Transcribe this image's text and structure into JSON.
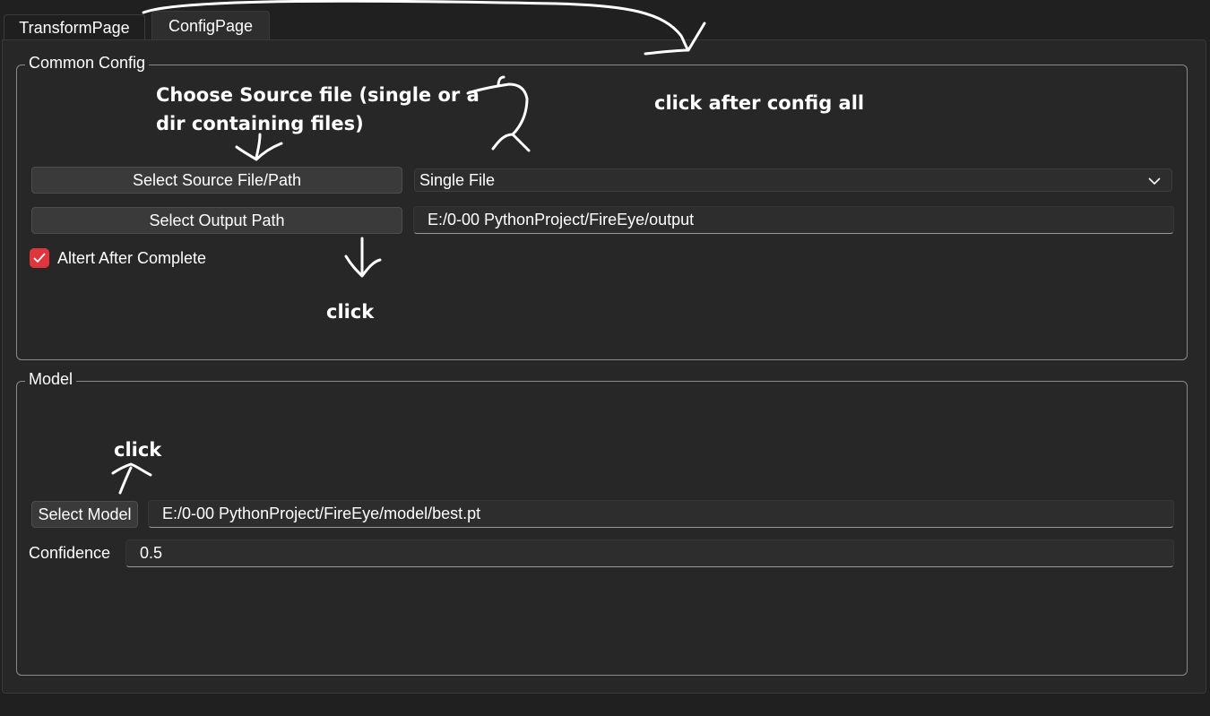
{
  "tabs": {
    "transform_label": "TransformPage",
    "config_label": "ConfigPage",
    "active": "ConfigPage"
  },
  "common_config": {
    "title": "Common Config",
    "select_source_label": "Select Source File/Path",
    "source_mode_selected": "Single File",
    "select_output_label": "Select Output Path",
    "output_path_value": "E:/0-00 PythonProject/FireEye/output",
    "alert_checkbox_label": "Altert After Complete",
    "alert_checked": true
  },
  "model": {
    "title": "Model",
    "select_model_label": "Select Model",
    "model_path_value": "E:/0-00 PythonProject/FireEye/model/best.pt",
    "confidence_label": "Confidence",
    "confidence_value": "0.5"
  },
  "annotations": {
    "choose_source_line1": "Choose Source file (single or a",
    "choose_source_line2": "dir containing files)",
    "click_after_config": "click after config all",
    "click_alert": "click",
    "click_model": "click"
  },
  "colors": {
    "background": "#202020",
    "panel": "#272727",
    "checkbox_accent": "#e0353d",
    "button": "#3a3a3a",
    "group_border": "#8a8a8a"
  },
  "icons": {
    "combo_arrow": "chevron-down-icon",
    "checkbox_mark": "checkmark-icon"
  }
}
